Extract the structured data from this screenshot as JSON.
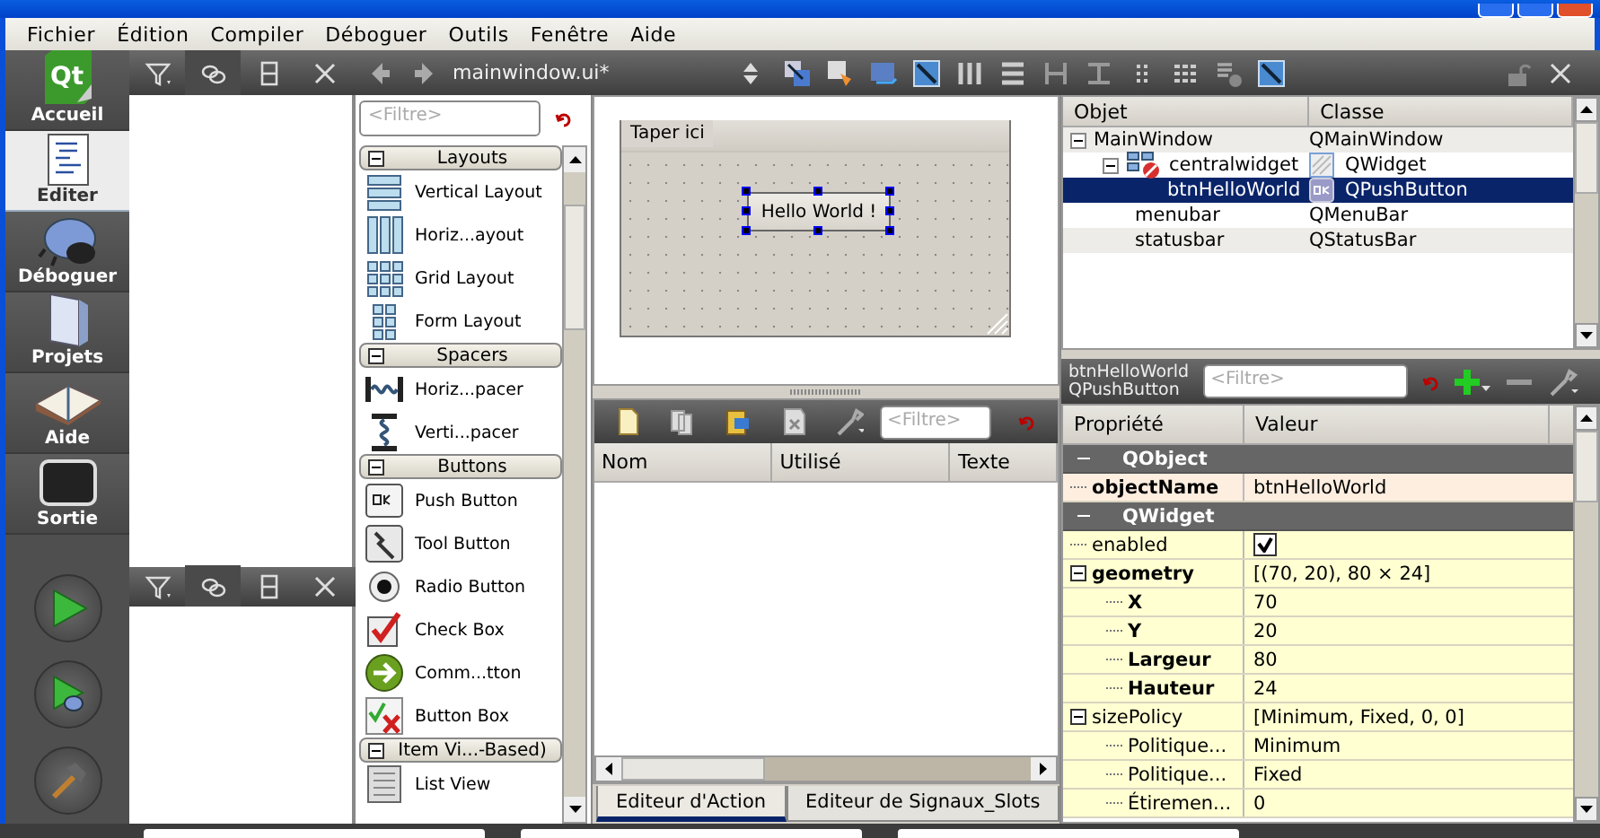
{
  "menu": [
    {
      "label": "Fichier"
    },
    {
      "label": "Édition"
    },
    {
      "label": "Compiler"
    },
    {
      "label": "Déboguer"
    },
    {
      "label": "Outils"
    },
    {
      "label": "Fenêtre"
    },
    {
      "label": "Aide"
    }
  ],
  "mode_bar": {
    "logo_text": "Qt",
    "modes": [
      {
        "label": "Accueil",
        "selected": false
      },
      {
        "label": "Editer",
        "selected": true
      },
      {
        "label": "Déboguer",
        "selected": false
      },
      {
        "label": "Projets",
        "selected": false
      },
      {
        "label": "Aide",
        "selected": false
      },
      {
        "label": "Sortie",
        "selected": false
      }
    ]
  },
  "editor_toolbar": {
    "file": "mainwindow.ui*"
  },
  "widget_box": {
    "filter_placeholder": "<Filtre>",
    "categories": [
      {
        "title": "Layouts",
        "expanded": true,
        "items": [
          {
            "label": "Vertical Layout"
          },
          {
            "label": "Horiz...ayout"
          },
          {
            "label": "Grid Layout"
          },
          {
            "label": "Form Layout"
          }
        ]
      },
      {
        "title": "Spacers",
        "expanded": true,
        "items": [
          {
            "label": "Horiz...pacer"
          },
          {
            "label": "Verti...pacer"
          }
        ]
      },
      {
        "title": "Buttons",
        "expanded": true,
        "items": [
          {
            "label": "Push Button"
          },
          {
            "label": "Tool Button"
          },
          {
            "label": "Radio Button"
          },
          {
            "label": "Check Box"
          },
          {
            "label": "Comm...tton"
          },
          {
            "label": "Button Box"
          }
        ]
      },
      {
        "title": "Item Vi...-Based)",
        "expanded": true,
        "items": [
          {
            "label": "List View"
          }
        ]
      }
    ]
  },
  "form": {
    "menu_placeholder": "Taper ici",
    "button_text": "Hello World !",
    "button_selected": true
  },
  "action_editor": {
    "filter_placeholder": "<Filtre>",
    "columns": [
      "Nom",
      "Utilisé",
      "Texte"
    ],
    "tabs": [
      {
        "label": "Editeur d'Action",
        "selected": true
      },
      {
        "label": "Editeur de Signaux_Slots",
        "selected": false
      }
    ]
  },
  "object_inspector": {
    "columns": [
      "Objet",
      "Classe"
    ],
    "tree": [
      {
        "object": "MainWindow",
        "class": "QMainWindow",
        "expanded": true,
        "selected": false,
        "children": [
          {
            "kind": "layout_widget",
            "object": "centralwidget",
            "class": "QWidget",
            "expanded": true,
            "selected": false,
            "children": [
              {
                "kind": "button",
                "object": "btnHelloWorld",
                "class": "QPushButton",
                "selected": true
              }
            ]
          },
          {
            "object": "menubar",
            "class": "QMenuBar",
            "selected": false
          },
          {
            "object": "statusbar",
            "class": "QStatusBar",
            "selected": false
          }
        ]
      }
    ]
  },
  "property_editor": {
    "object_name": "btnHelloWorld",
    "class_name": "QPushButton",
    "filter_placeholder": "<Filtre>",
    "columns": [
      "Propriété",
      "Valeur"
    ],
    "groups": [
      {
        "name": "QObject",
        "expanded": true,
        "color": "#fdeee0",
        "properties": [
          {
            "name": "objectName",
            "kind": "text",
            "value": "btnHelloWorld",
            "modified": true
          }
        ]
      },
      {
        "name": "QWidget",
        "expanded": true,
        "color": "#ffffd2",
        "properties": [
          {
            "name": "enabled",
            "kind": "check",
            "checked": true,
            "modified": false
          },
          {
            "name": "geometry",
            "kind": "text",
            "value": "[(70, 20), 80 × 24]",
            "modified": true,
            "expanded": true,
            "children": [
              {
                "name": "X",
                "kind": "text",
                "value": "70",
                "modified": true
              },
              {
                "name": "Y",
                "kind": "text",
                "value": "20",
                "modified": true
              },
              {
                "name": "Largeur",
                "kind": "text",
                "value": "80",
                "modified": true
              },
              {
                "name": "Hauteur",
                "kind": "text",
                "value": "24",
                "modified": true
              }
            ]
          },
          {
            "name": "sizePolicy",
            "kind": "text",
            "value": "[Minimum, Fixed, 0, 0]",
            "modified": false,
            "expanded": true,
            "children": [
              {
                "name": "Politique...",
                "kind": "text",
                "value": "Minimum",
                "modified": false
              },
              {
                "name": "Politique...",
                "kind": "text",
                "value": "Fixed",
                "modified": false
              },
              {
                "name": "Étiremen...",
                "kind": "text",
                "value": "0",
                "modified": false
              }
            ]
          }
        ]
      }
    ]
  }
}
